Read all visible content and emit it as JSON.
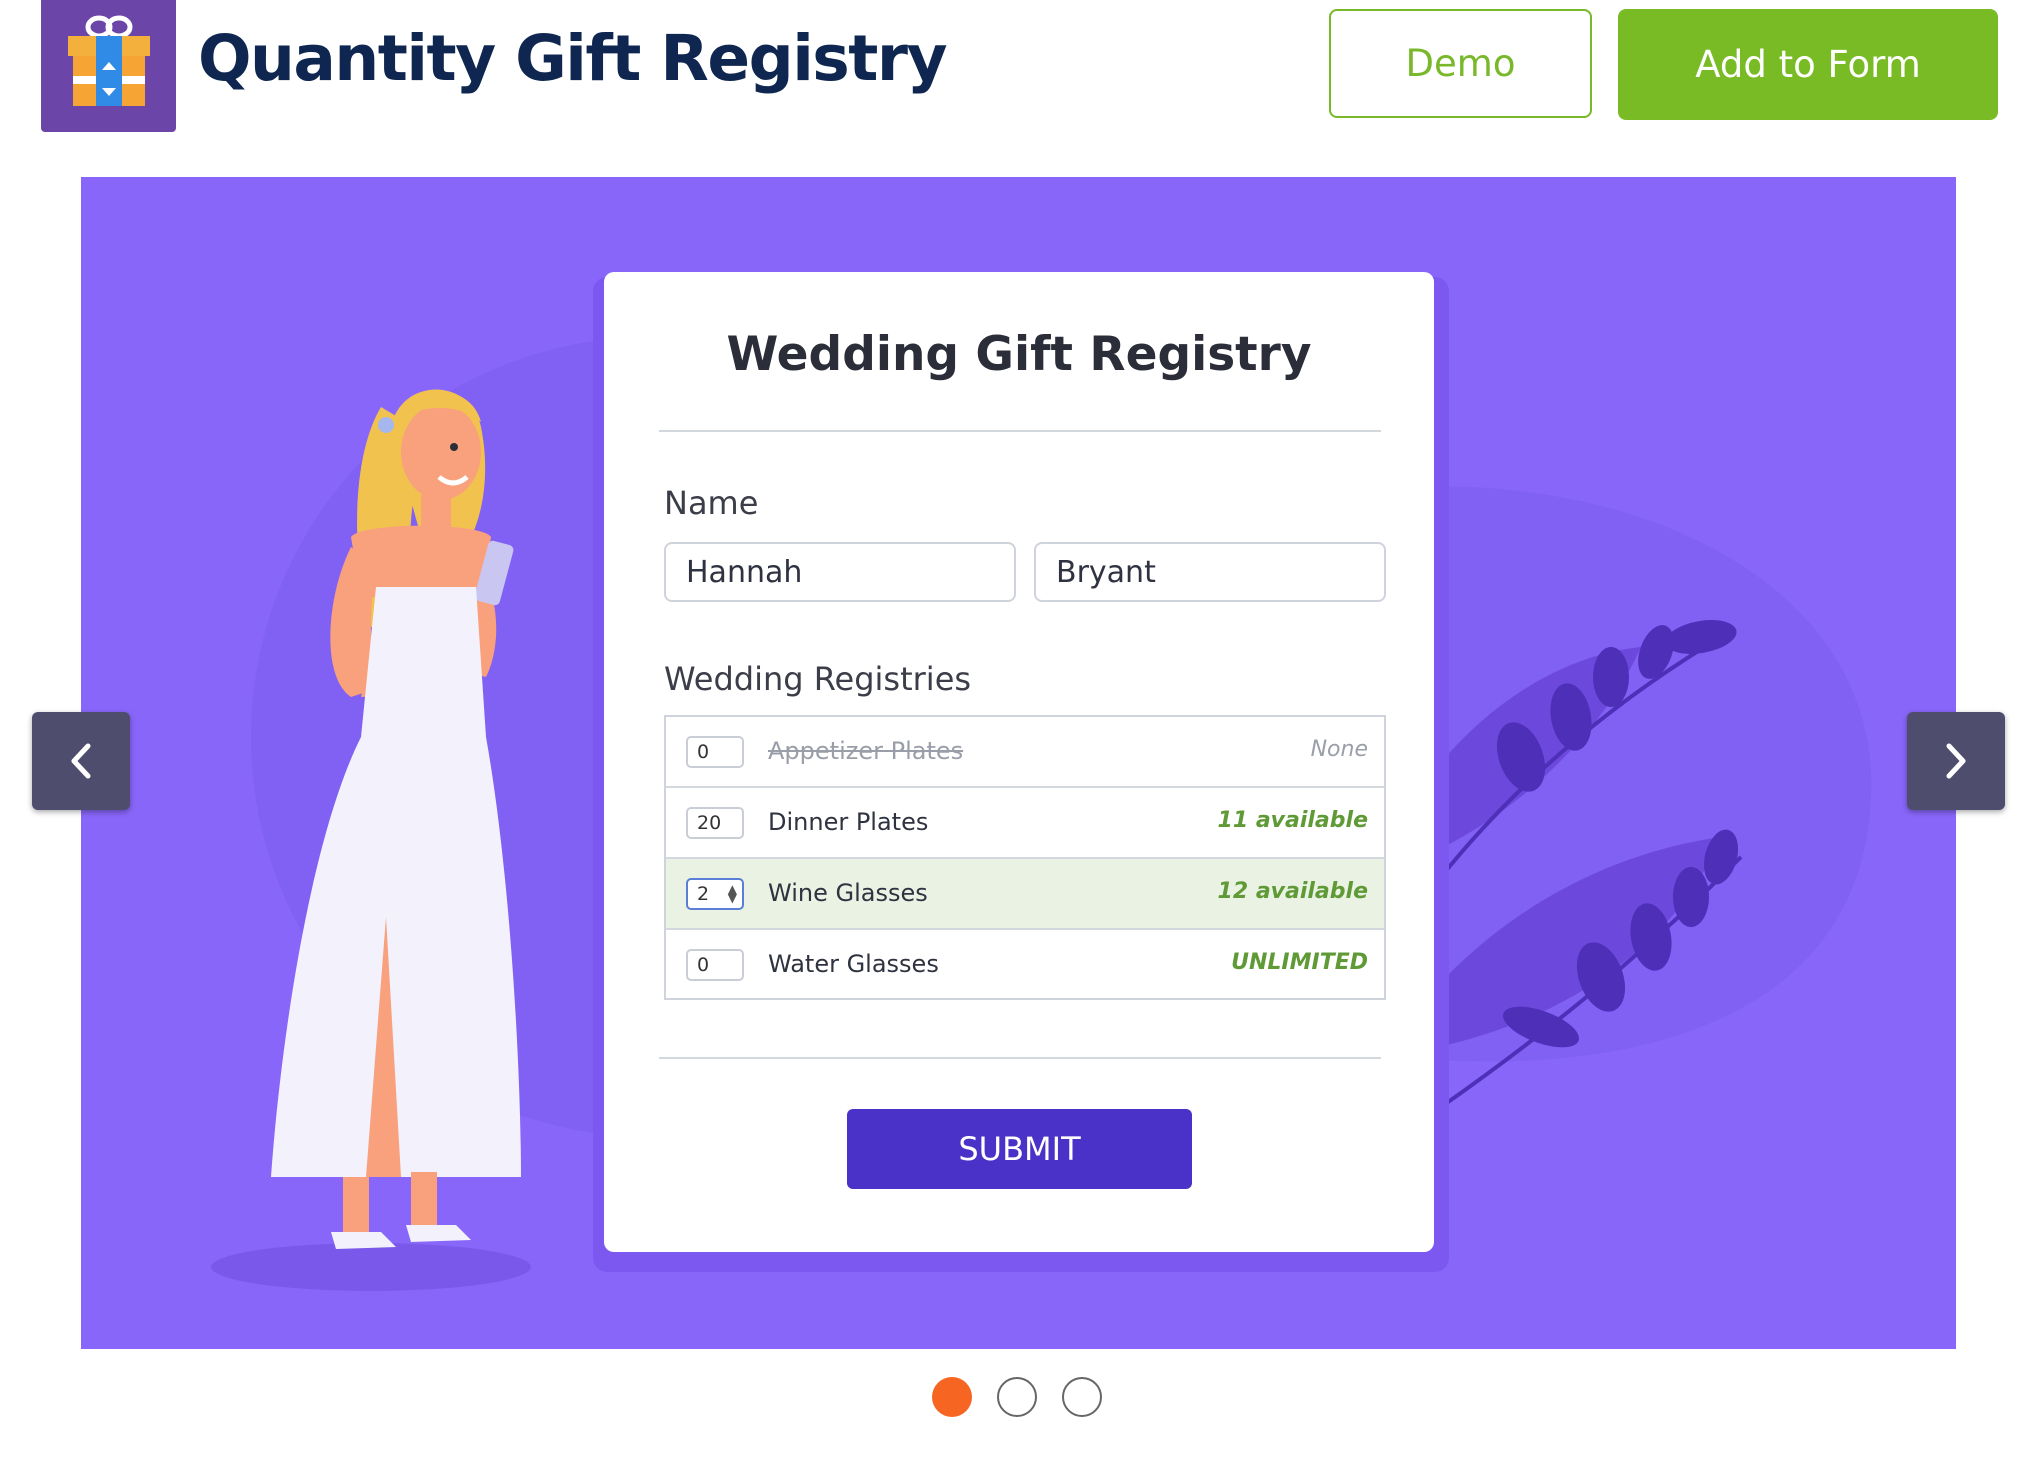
{
  "header": {
    "title": "Quantity Gift Registry",
    "demo_label": "Demo",
    "add_label": "Add to Form"
  },
  "form": {
    "title": "Wedding Gift Registry",
    "name_label": "Name",
    "first_name": "Hannah",
    "last_name": "Bryant",
    "registries_label": "Wedding Registries",
    "items": [
      {
        "qty": "0",
        "name": "Appetizer Plates",
        "availability": "None",
        "sold_out": true
      },
      {
        "qty": "20",
        "name": "Dinner Plates",
        "availability": "11 available"
      },
      {
        "qty": "2",
        "name": "Wine Glasses",
        "availability": "12 available",
        "selected": true
      },
      {
        "qty": "0",
        "name": "Water Glasses",
        "availability": "UNLIMITED"
      }
    ],
    "submit_label": "SUBMIT"
  },
  "carousel": {
    "slide_count": 3,
    "active_slide": 1
  },
  "colors": {
    "title": "#0f2750",
    "accent_green": "#78bb24",
    "slide_bg": "#8966fa",
    "submit": "#4a32c8",
    "active_dot": "#f76522"
  },
  "icons": [
    "gift-icon",
    "chevron-left-icon",
    "chevron-right-icon"
  ]
}
